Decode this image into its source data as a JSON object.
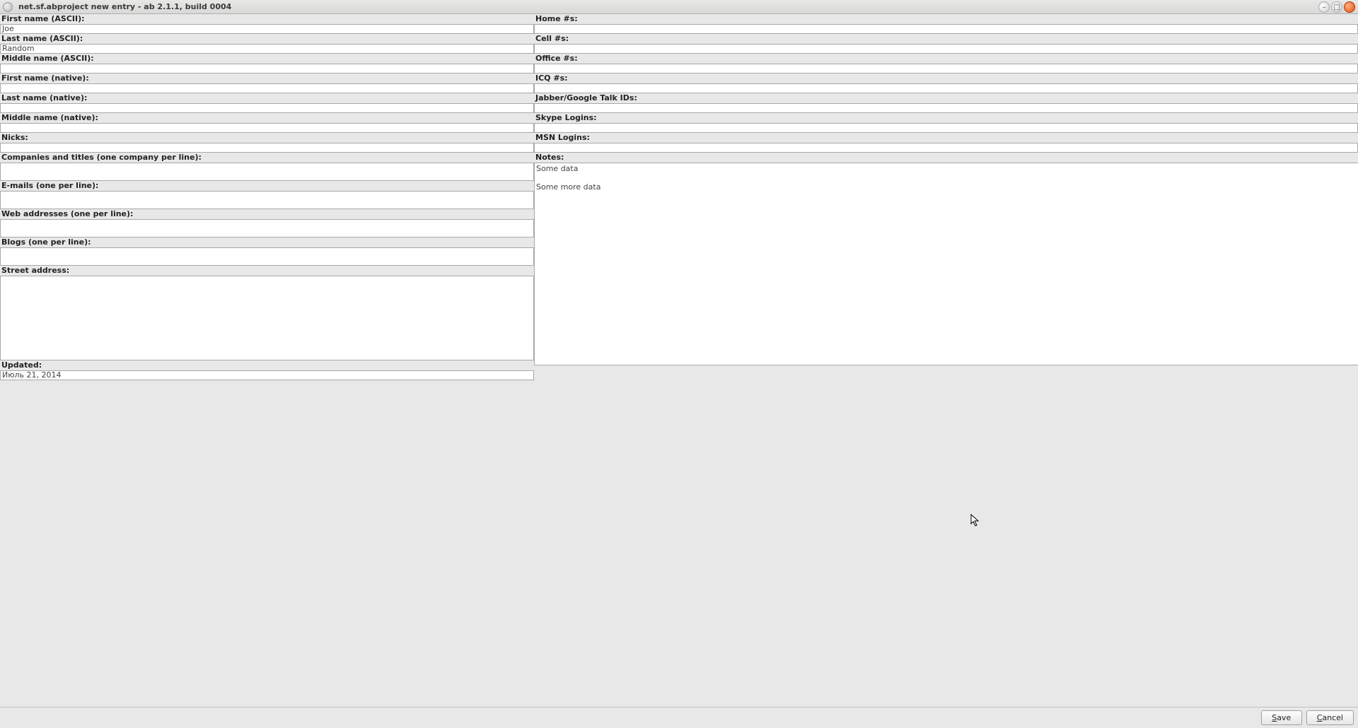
{
  "window": {
    "title": "net.sf.abproject new entry - ab 2.1.1, build 0004"
  },
  "labels": {
    "first_name_ascii": "First name (ASCII):",
    "last_name_ascii": "Last name (ASCII):",
    "middle_name_ascii": "Middle name (ASCII):",
    "first_name_native": "First name (native):",
    "last_name_native": "Last name (native):",
    "middle_name_native": "Middle name (native):",
    "nicks": "Nicks:",
    "companies": "Companies and titles (one company per line):",
    "emails": "E-mails (one per line):",
    "web": "Web addresses (one per line):",
    "blogs": "Blogs (one per line):",
    "street": "Street address:",
    "updated": "Updated:",
    "home": "Home #s:",
    "cell": "Cell #s:",
    "office": "Office #s:",
    "icq": "ICQ #s:",
    "jabber": "Jabber/Google Talk IDs:",
    "skype": "Skype Logins:",
    "msn": "MSN Logins:",
    "notes": "Notes:"
  },
  "values": {
    "first_name_ascii": "Joe",
    "last_name_ascii": "Random",
    "middle_name_ascii": "",
    "first_name_native": "",
    "last_name_native": "",
    "middle_name_native": "",
    "nicks": "",
    "companies": "",
    "emails": "",
    "web": "",
    "blogs": "",
    "street": "",
    "updated": "Июль 21, 2014",
    "home": "",
    "cell": "",
    "office": "",
    "icq": "",
    "jabber": "",
    "skype": "",
    "msn": "",
    "notes": "Some data\n\nSome more data"
  },
  "buttons": {
    "save": "Save",
    "cancel": "Cancel"
  }
}
